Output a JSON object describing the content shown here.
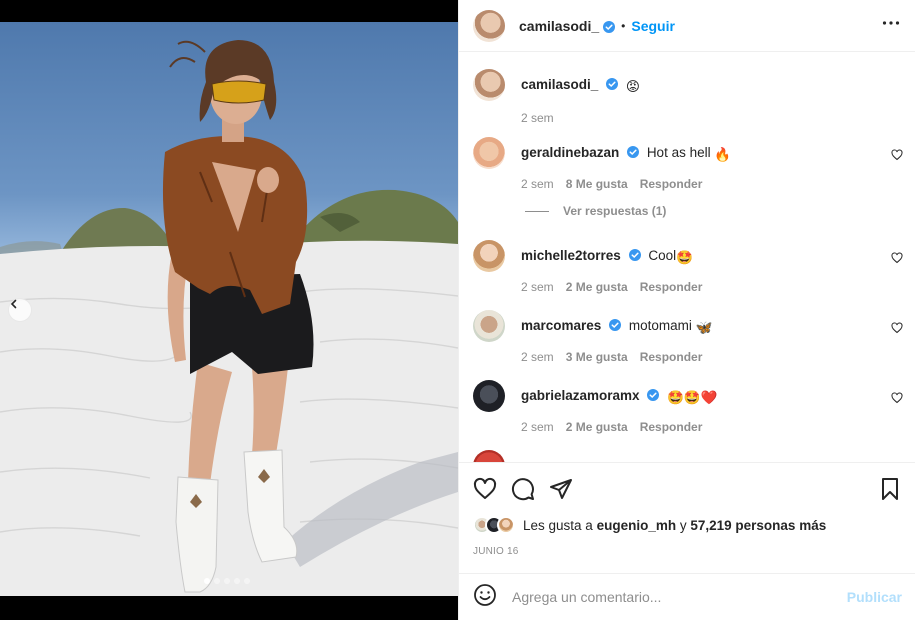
{
  "post": {
    "author": "camilasodi_",
    "follow_label": "Seguir",
    "caption_emoji": "😡",
    "caption_time": "2 sem",
    "date": "JUNIO 16",
    "likes": {
      "prefix": "Les gusta a",
      "user": "eugenio_mh",
      "connector": "y",
      "count_text": "57,219 personas más"
    },
    "carousel": {
      "slides": 5,
      "active_index": 0
    }
  },
  "comments": [
    {
      "user": "geraldinebazan",
      "verified": true,
      "text": "Hot as hell",
      "emoji": "🔥",
      "time": "2 sem",
      "likes": "8 Me gusta",
      "reply": "Responder",
      "view_replies": "Ver respuestas (1)"
    },
    {
      "user": "michelle2torres",
      "verified": true,
      "text": "Cool",
      "emoji": "🤩",
      "time": "2 sem",
      "likes": "2 Me gusta",
      "reply": "Responder"
    },
    {
      "user": "marcomares",
      "verified": true,
      "text": "motomami",
      "emoji": "🦋",
      "time": "2 sem",
      "likes": "3 Me gusta",
      "reply": "Responder"
    },
    {
      "user": "gabrielazamoramx",
      "verified": true,
      "text": "",
      "emoji": "🤩🤩❤️",
      "time": "2 sem",
      "likes": "2 Me gusta",
      "reply": "Responder"
    }
  ],
  "composer": {
    "placeholder": "Agrega un comentario...",
    "publish_label": "Publicar"
  },
  "colors": {
    "link_blue": "#0095f6",
    "publish_disabled": "#b2dffc",
    "muted_text": "#8e8e8e",
    "verified_blue": "#3897f0"
  },
  "icons": [
    "smile-icon",
    "heart-icon",
    "comment-icon",
    "share-icon",
    "bookmark-icon",
    "more-icon",
    "chevron-left-icon",
    "verified-icon"
  ]
}
